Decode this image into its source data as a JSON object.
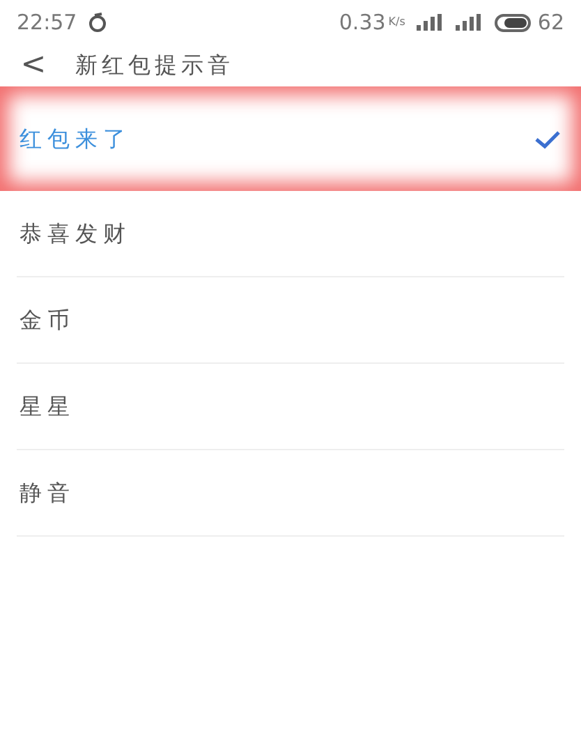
{
  "status_bar": {
    "time": "22:57",
    "speed": "0.33",
    "speed_unit": "K/s",
    "battery": "62"
  },
  "header": {
    "back": "<",
    "title": "新红包提示音"
  },
  "options": [
    {
      "label": "红包来了",
      "selected": true
    },
    {
      "label": "恭喜发财",
      "selected": false
    },
    {
      "label": "金币",
      "selected": false
    },
    {
      "label": "星星",
      "selected": false
    },
    {
      "label": "静音",
      "selected": false
    }
  ]
}
